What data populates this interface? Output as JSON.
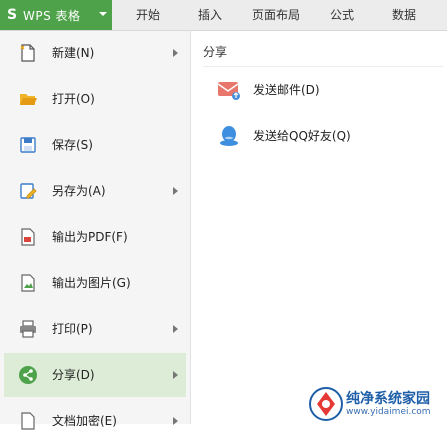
{
  "app": {
    "logo_glyph": "S",
    "title": "WPS 表格",
    "accent": "#4ea24a"
  },
  "ribbon_tabs": [
    "开始",
    "插入",
    "页面布局",
    "公式",
    "数据"
  ],
  "menu": {
    "items": [
      {
        "label": "新建(N)",
        "icon": "new-file-icon",
        "has_submenu": true
      },
      {
        "label": "打开(O)",
        "icon": "open-folder-icon",
        "has_submenu": false
      },
      {
        "label": "保存(S)",
        "icon": "save-icon",
        "has_submenu": false
      },
      {
        "label": "另存为(A)",
        "icon": "save-as-icon",
        "has_submenu": true
      },
      {
        "label": "输出为PDF(F)",
        "icon": "pdf-icon",
        "has_submenu": false
      },
      {
        "label": "输出为图片(G)",
        "icon": "image-icon",
        "has_submenu": false
      },
      {
        "label": "打印(P)",
        "icon": "printer-icon",
        "has_submenu": true
      },
      {
        "label": "分享(D)",
        "icon": "share-icon",
        "has_submenu": true,
        "active": true
      },
      {
        "label": "文档加密(E)",
        "icon": "lock-icon",
        "has_submenu": true
      }
    ],
    "active_color": "#dcecd6"
  },
  "share_panel": {
    "title": "分享",
    "items": [
      {
        "label": "发送邮件(D)",
        "icon": "mail-icon"
      },
      {
        "label": "发送给QQ好友(Q)",
        "icon": "qq-icon"
      }
    ]
  },
  "watermark": {
    "line1": "纯净系统家园",
    "line2": "www.yidaimei.com"
  }
}
